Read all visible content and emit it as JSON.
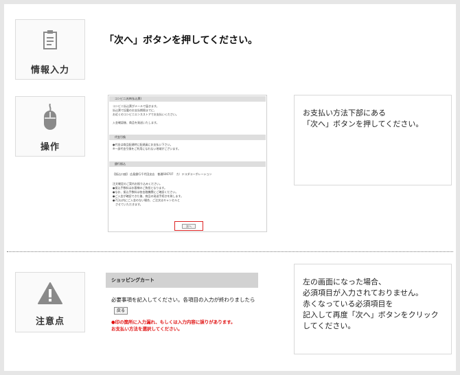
{
  "steps": [
    {
      "label": "情報入力",
      "icon": "clipboard-icon"
    },
    {
      "label": "操作",
      "icon": "mouse-icon"
    },
    {
      "label": "注意点",
      "icon": "warning-icon"
    }
  ],
  "title": "「次へ」ボタンを押してください。",
  "note1": {
    "lines": [
      "お支払い方法下部にある",
      "「次へ」ボタンを押してください。"
    ]
  },
  "note2": {
    "lines": [
      "左の画面になった場合、",
      "必須項目が入力されておりません。",
      "赤くなっている必須項目を",
      "記入して再度「次へ」ボタンをクリック",
      "してください。"
    ]
  },
  "shot1": {
    "sections": [
      "コンビニ決済(払込票)",
      "代金引換",
      "銀行振込"
    ],
    "conv_lines": [
      "コンビニ払込票がメールで届きます。",
      "払込票で記載のお支払期限までに、",
      "お近くのコンビニエンスストアでお支払いください。",
      "",
      "入金確認後、商品を発送いたします。"
    ],
    "cod_lines": [
      "●代金は商品配達時に配達員にお支払い下さい。",
      "※一部代金引換をご利用になれない地域がございます。"
    ],
    "bank_lines": [
      "【振込口座】 広島銀行千代田支店　普通606707　カ）テコダコーポレーション",
      "",
      "注文確定のご案内お振り込みください。",
      "●振込手数料はお客様のご負担となります。",
      "●なお、振込手数料は各金融機関にご確認ください。",
      "●ご入金が確認できた後、商品の発送手続きを致します。",
      "●7日以内にご入金のない場合、ご注文はキャンセルと",
      "　させていただきます。"
    ],
    "next_label": "次へ"
  },
  "shot2": {
    "header": "ショッピングカート",
    "message": "必要事項を記入してください。各項目の入力が終わりましたら",
    "back_label": "戻る",
    "errors": [
      "●印の箇所に入力漏れ、もしくは入力内容に誤りがあります。",
      "お支払い方法を選択してください。"
    ]
  },
  "colors": {
    "accent_red": "#e01010",
    "icon_gray": "#8a8a8a",
    "background": "#e6e6e6"
  }
}
